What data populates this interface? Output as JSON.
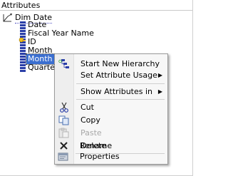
{
  "panel": {
    "title": "Attributes"
  },
  "tree": {
    "dimension": {
      "label": "Dim Date",
      "icon": "dimension-icon"
    },
    "attributes": [
      {
        "label": "Date",
        "icon": "attribute-icon",
        "selected": false
      },
      {
        "label": "Fiscal Year Name",
        "icon": "attribute-icon",
        "selected": false
      },
      {
        "label": "ID",
        "icon": "key-attribute-icon",
        "selected": false
      },
      {
        "label": "Month",
        "icon": "attribute-icon",
        "selected": false
      },
      {
        "label": "Month Name",
        "icon": "attribute-icon",
        "selected": true
      },
      {
        "label": "Quarte",
        "icon": "attribute-icon",
        "selected": false
      }
    ]
  },
  "context_menu": {
    "items": [
      {
        "label": "Start New Hierarchy",
        "icon": "hierarchy-icon",
        "has_submenu": false,
        "enabled": true
      },
      {
        "label": "Set Attribute Usage",
        "icon": "",
        "has_submenu": true,
        "enabled": true
      },
      {
        "label": "Show Attributes in",
        "icon": "",
        "has_submenu": true,
        "enabled": true
      },
      {
        "label": "Cut",
        "icon": "scissors-icon",
        "has_submenu": false,
        "enabled": true
      },
      {
        "label": "Copy",
        "icon": "copy-icon",
        "has_submenu": false,
        "enabled": true
      },
      {
        "label": "Paste",
        "icon": "paste-icon",
        "has_submenu": false,
        "enabled": false
      },
      {
        "label": "Delete",
        "icon": "delete-x-icon",
        "has_submenu": false,
        "enabled": true
      },
      {
        "label": "Rename",
        "icon": "",
        "has_submenu": false,
        "enabled": true
      },
      {
        "label": "Properties",
        "icon": "properties-icon",
        "has_submenu": false,
        "enabled": true
      }
    ],
    "submenu_arrow": "▶"
  },
  "colors": {
    "selection": "#3b6fd0",
    "attribute_icon": "#2b3fa8",
    "menu_bg": "#f7f7f7",
    "disabled_text": "#a8a8a8"
  }
}
